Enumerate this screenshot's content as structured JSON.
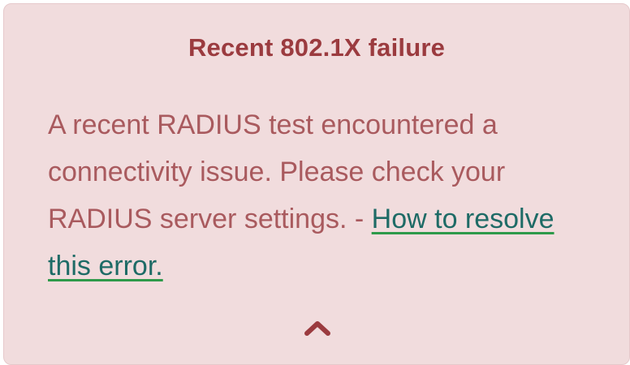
{
  "alert": {
    "title": "Recent 802.1X failure",
    "message": "A recent RADIUS test encountered a connectivity issue. Please check your RADIUS server settings. -",
    "link_text": "How to resolve this error.",
    "collapse_icon": "chevron-up-icon",
    "colors": {
      "background": "#f1dcdd",
      "title": "#9b3b3f",
      "text": "#a95a5e",
      "link": "#1e6b66",
      "link_underline": "#2e9a4a"
    }
  }
}
